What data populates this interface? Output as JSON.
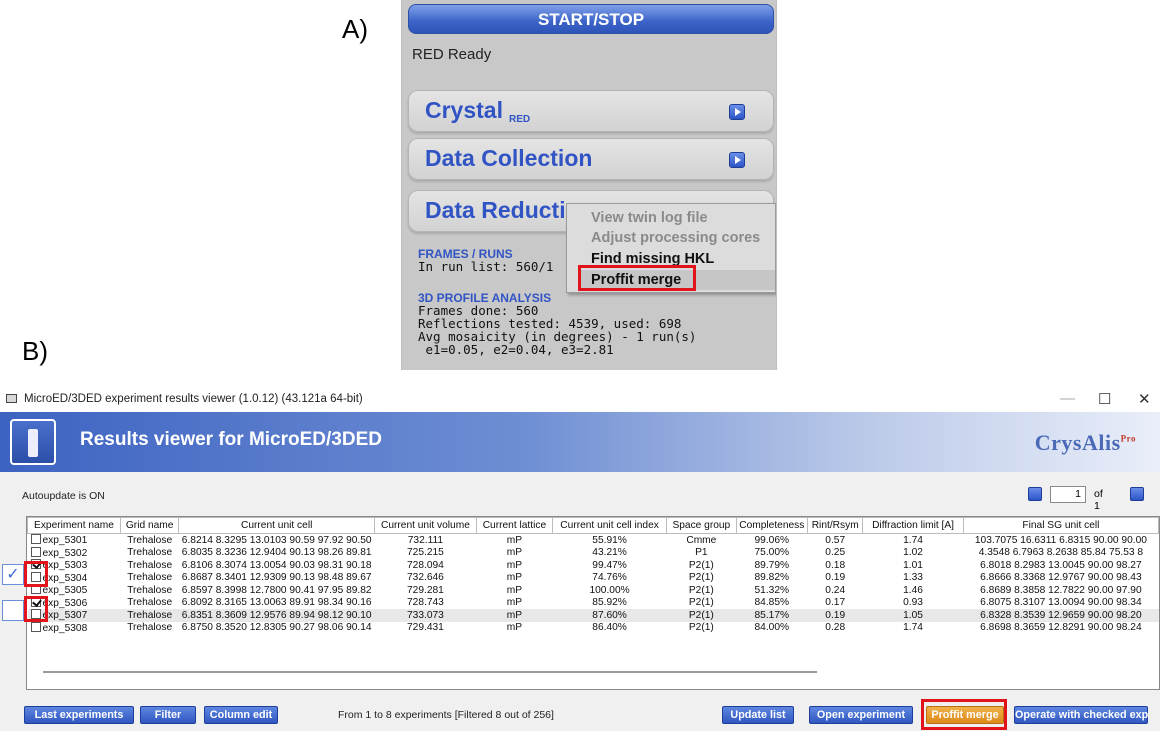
{
  "labels": {
    "panel_a": "A)",
    "panel_b": "B)"
  },
  "panel_a": {
    "start_stop": "START/STOP",
    "status": "RED Ready",
    "sections": [
      {
        "title": "Crystal",
        "sub": "RED"
      },
      {
        "title": "Data Collection",
        "sub": ""
      },
      {
        "title": "Data Reducti",
        "sub": ""
      }
    ],
    "frames_heading": "FRAMES / RUNS",
    "run_list": "In run list: 560/1",
    "profile_heading": "3D PROFILE ANALYSIS",
    "profile_lines": [
      "Frames done: 560",
      "Reflections tested: 4539, used: 698",
      "Avg mosaicity (in degrees) - 1 run(s)",
      " e1=0.05, e2=0.04, e3=2.81"
    ],
    "context_menu": [
      {
        "label": "View twin log file",
        "enabled": false
      },
      {
        "label": "Adjust processing cores",
        "enabled": false
      },
      {
        "label": "Find missing HKL",
        "enabled": true
      },
      {
        "label": "Proffit merge",
        "enabled": true
      }
    ]
  },
  "panel_b": {
    "window_title": "MicroED/3DED experiment results viewer (1.0.12) (43.121a 64-bit)",
    "window_controls": {
      "minimize": "—",
      "maximize": "☐",
      "close": "✕"
    },
    "banner_title": "Results viewer for MicroED/3DED",
    "logo": {
      "text": "CrysAlis",
      "sup": "Pro"
    },
    "autoupdate": "Autoupdate is ON",
    "pager": {
      "page": "1",
      "of": "of 1"
    },
    "columns": [
      "Experiment name",
      "Grid name",
      "Current unit cell",
      "Current unit volume",
      "Current lattice",
      "Current unit cell index",
      "Space group",
      "Completeness",
      "Rint/Rsym",
      "Diffraction limit [A]",
      "Final SG unit cell"
    ],
    "rows": [
      {
        "checked": false,
        "cells": [
          "exp_5301",
          "Trehalose",
          "6.8214 8.3295 13.0103 90.59 97.92 90.50",
          "732.111",
          "mP",
          "55.91%",
          "Cmme",
          "99.06%",
          "0.57",
          "1.74",
          "103.7075 16.6311 6.8315 90.00 90.00"
        ]
      },
      {
        "checked": false,
        "cells": [
          "exp_5302",
          "Trehalose",
          "6.8035 8.3236 12.9404 90.13 98.26 89.81",
          "725.215",
          "mP",
          "43.21%",
          "P1",
          "75.00%",
          "0.25",
          "1.02",
          "4.3548 6.7963 8.2638 85.84 75.53 8"
        ]
      },
      {
        "checked": true,
        "cells": [
          "exp_5303",
          "Trehalose",
          "6.8106 8.3074 13.0054 90.03 98.31 90.18",
          "728.094",
          "mP",
          "99.47%",
          "P2(1)",
          "89.79%",
          "0.18",
          "1.01",
          "6.8018 8.2983 13.0045 90.00 98.27"
        ]
      },
      {
        "checked": false,
        "cells": [
          "exp_5304",
          "Trehalose",
          "6.8687 8.3401 12.9309 90.13 98.48 89.67",
          "732.646",
          "mP",
          "74.76%",
          "P2(1)",
          "89.82%",
          "0.19",
          "1.33",
          "6.8666 8.3368 12.9767 90.00 98.43"
        ]
      },
      {
        "checked": false,
        "cells": [
          "exp_5305",
          "Trehalose",
          "6.8597 8.3998 12.7800 90.41 97.95 89.82",
          "729.281",
          "mP",
          "100.00%",
          "P2(1)",
          "51.32%",
          "0.24",
          "1.46",
          "6.8689 8.3858 12.7822 90.00 97.90"
        ]
      },
      {
        "checked": true,
        "cells": [
          "exp_5306",
          "Trehalose",
          "6.8092 8.3165 13.0063 89.91 98.34 90.16",
          "728.743",
          "mP",
          "85.92%",
          "P2(1)",
          "84.85%",
          "0.17",
          "0.93",
          "6.8075 8.3107 13.0094 90.00 98.34"
        ]
      },
      {
        "checked": false,
        "selected": true,
        "cells": [
          "exp_5307",
          "Trehalose",
          "6.8351 8.3609 12.9576 89.94 98.12 90.10",
          "733.073",
          "mP",
          "87.60%",
          "P2(1)",
          "85.17%",
          "0.19",
          "1.05",
          "6.8328 8.3539 12.9659 90.00 98.20"
        ]
      },
      {
        "checked": false,
        "cells": [
          "exp_5308",
          "Trehalose",
          "6.8750 8.3520 12.8305 90.27 98.06 90.14",
          "729.431",
          "mP",
          "86.40%",
          "P2(1)",
          "84.00%",
          "0.28",
          "1.74",
          "6.8698 8.3659 12.8291 90.00 98.24"
        ]
      }
    ],
    "side_checks": [
      "✓",
      ""
    ],
    "status_text": "From 1 to 8 experiments [Filtered 8 out of 256]",
    "buttons": {
      "last_experiments": "Last experiments",
      "filter": "Filter",
      "column_edit": "Column edit",
      "update_list": "Update list",
      "open_experiment": "Open experiment",
      "proffit_merge": "Proffit merge",
      "operate": "Operate with checked exp"
    },
    "accent": "#2f57c0",
    "highlight_color": "#e0141a"
  }
}
